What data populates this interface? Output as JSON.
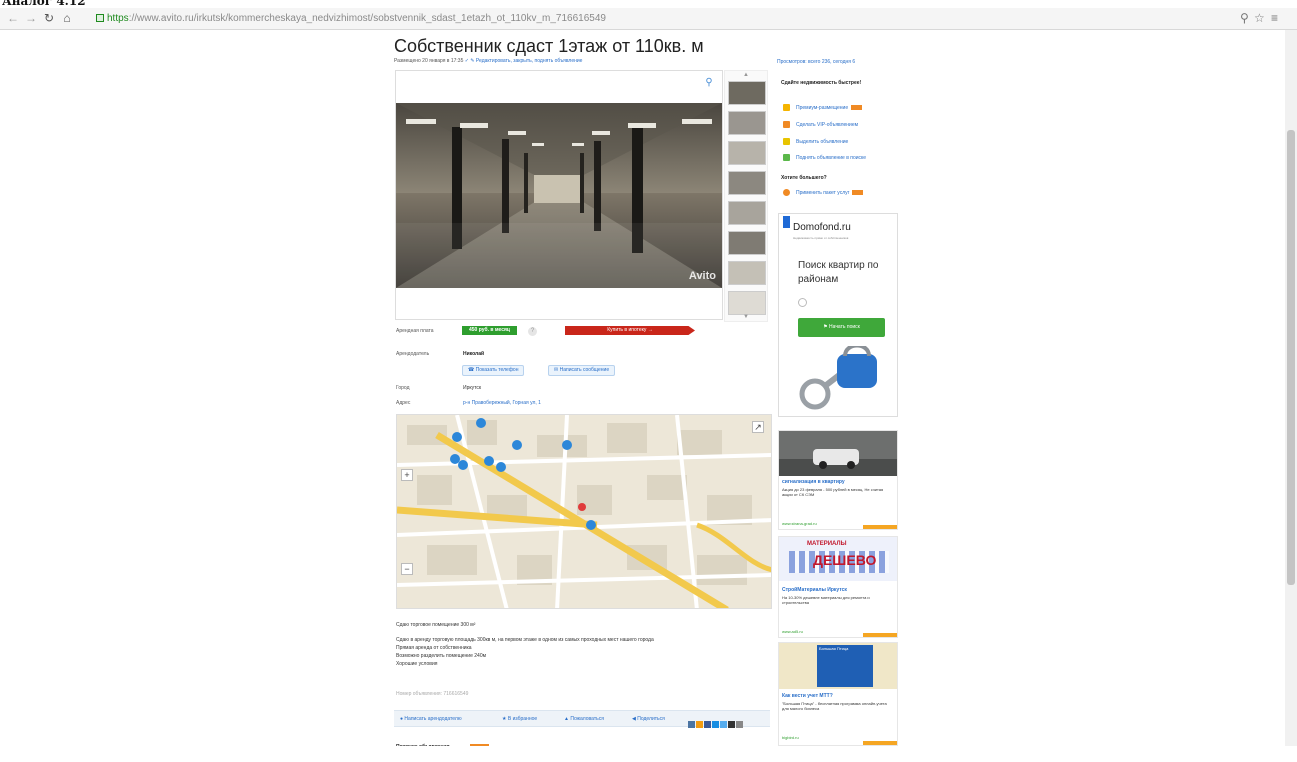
{
  "browser": {
    "tab_title": "Аналог 4.12",
    "url_https": "https",
    "url_rest": "://www.avito.ru/irkutsk/kommercheskaya_nedvizhimost/sobstvennik_sdast_1etazh_ot_110kv_m_716616549",
    "back_icon": "arrow-left-icon",
    "forward_icon": "arrow-right-icon",
    "reload_icon": "reload-icon",
    "home_icon": "home-icon",
    "right_icons": [
      "zoom-icon",
      "star-icon",
      "menu-icon"
    ]
  },
  "listing": {
    "title": "Собственник сдаст 1этаж от 110кв. м",
    "posted": "Размещено 20 января в 17:35",
    "edit_links": "✓ ✎  Редактировать, закрыть, поднять объявление",
    "photo_watermark": "Avito",
    "rows": {
      "price_label": "Арендная плата",
      "price_value": "450 руб. в месяц",
      "buy_button": "Купить в ипотеку →",
      "seller_label": "Арендодатель",
      "seller_name": "Николай",
      "call_button": "Показать телефон",
      "message_button": "Написать сообщение",
      "city_label": "Город",
      "city_value": "Иркутск",
      "address_label": "Адрес",
      "address_value": "р-н Правобережный, Горная ул, 1"
    },
    "description": {
      "heading": "Сдаю торговое помещение 300 м²",
      "lines": [
        "Сдаю в аренду торговую площадь 300кв м, на первом этаже в одном из самых проходных мест нашего города",
        "Прямая аренда от собственника",
        "Возможно разделить помещение 240м",
        "Хорошие условия"
      ],
      "ad_number": "Номер объявления: 716616549"
    },
    "actions": [
      "Написать арендодателю",
      "В избранное",
      "Пожаловаться",
      "Поделиться"
    ],
    "recent_label": "Похожие объявления"
  },
  "sidebar": {
    "views": "Просмотров: всего 236, сегодня 6",
    "sell_title": "Сдайте недвижимость быстрее!",
    "sell_items": [
      {
        "label": "Премиум-размещение",
        "icon": "star-icon",
        "color": "#f5b400",
        "badge": true
      },
      {
        "label": "Сделать VIP-объявлением",
        "icon": "vip-icon",
        "color": "#f08a24",
        "badge": false
      },
      {
        "label": "Выделить объявление",
        "icon": "highlight-icon",
        "color": "#e8c400",
        "badge": false
      },
      {
        "label": "Поднять объявление в поиске",
        "icon": "arrow-up-icon",
        "color": "#5bb84a",
        "badge": false
      }
    ],
    "more_title": "Хотите большего?",
    "more_item": {
      "label": "Применить пакет услуг",
      "icon": "package-icon",
      "color": "#f08a24"
    },
    "promo": {
      "logo": "Domofond.ru",
      "sub": "Недвижимость прямо от собственников",
      "text": "Поиск квартир по районам",
      "button": "Начать поиск"
    },
    "ads": [
      {
        "title": "сигнализация в квартиру",
        "text": "Акция до 23 февраля - 500 рублей в месяц. Не считая акции от СК СЭМ",
        "site": "www.strana-grad.ru"
      },
      {
        "title": "СтройМатериалы Иркутск",
        "text": "На 10-30% дешевле материалы для ремонта и строительства",
        "site": "www.ad5.ru",
        "banner_top": "МАТЕРИАЛЫ",
        "banner_main": "ДЕШЕВО"
      },
      {
        "title": "Как вести учет МТТ?",
        "text": "\"Большая Птица\" - бесплатная программа онлайн-учета для малого бизнеса",
        "site": "bigbird.ru",
        "banner": "Большая Птица"
      }
    ]
  }
}
